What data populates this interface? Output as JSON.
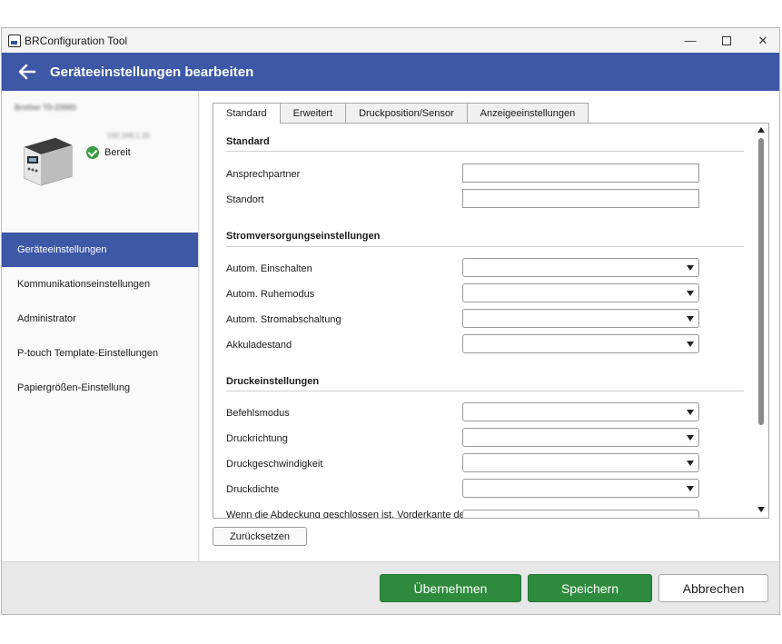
{
  "window": {
    "title": "BRConfiguration Tool",
    "min_label": "—",
    "close_label": "✕"
  },
  "header": {
    "title": "Geräteeinstellungen bearbeiten"
  },
  "device": {
    "name": "Brother TD-2350D",
    "ip": "192.168.1.20",
    "status": "Bereit",
    "status_color": "#3b9b44"
  },
  "sidebar": {
    "items": [
      {
        "label": "Geräteeinstellungen",
        "active": true
      },
      {
        "label": "Kommunikationseinstellungen",
        "active": false
      },
      {
        "label": "Administrator",
        "active": false
      },
      {
        "label": "P-touch Template-Einstellungen",
        "active": false
      },
      {
        "label": "Papiergrößen-Einstellung",
        "active": false
      }
    ]
  },
  "tabs": [
    "Standard",
    "Erweitert",
    "Druckposition/Sensor",
    "Anzeigeeinstellungen"
  ],
  "panel": {
    "sections": {
      "standard": {
        "title": "Standard",
        "contact_label": "Ansprechpartner",
        "contact_value": "",
        "location_label": "Standort",
        "location_value": ""
      },
      "power": {
        "title": "Stromversorgungseinstellungen",
        "auto_on": "Autom. Einschalten",
        "sleep": "Autom. Ruhemodus",
        "auto_off": "Autom. Stromabschaltung",
        "battery": "Akkuladestand"
      },
      "print": {
        "title": "Druckeinstellungen",
        "command_mode": "Befehlsmodus",
        "direction": "Druckrichtung",
        "speed": "Druckgeschwindigkeit",
        "density": "Druckdichte",
        "cover": "Wenn die Abdeckung geschlossen ist, Vorderkante des"
      }
    }
  },
  "buttons": {
    "reset": "Zurücksetzen",
    "apply": "Übernehmen",
    "save": "Speichern",
    "cancel": "Abbrechen"
  },
  "colors": {
    "accent": "#3d58a7",
    "primary_button": "#2e8b3e"
  }
}
